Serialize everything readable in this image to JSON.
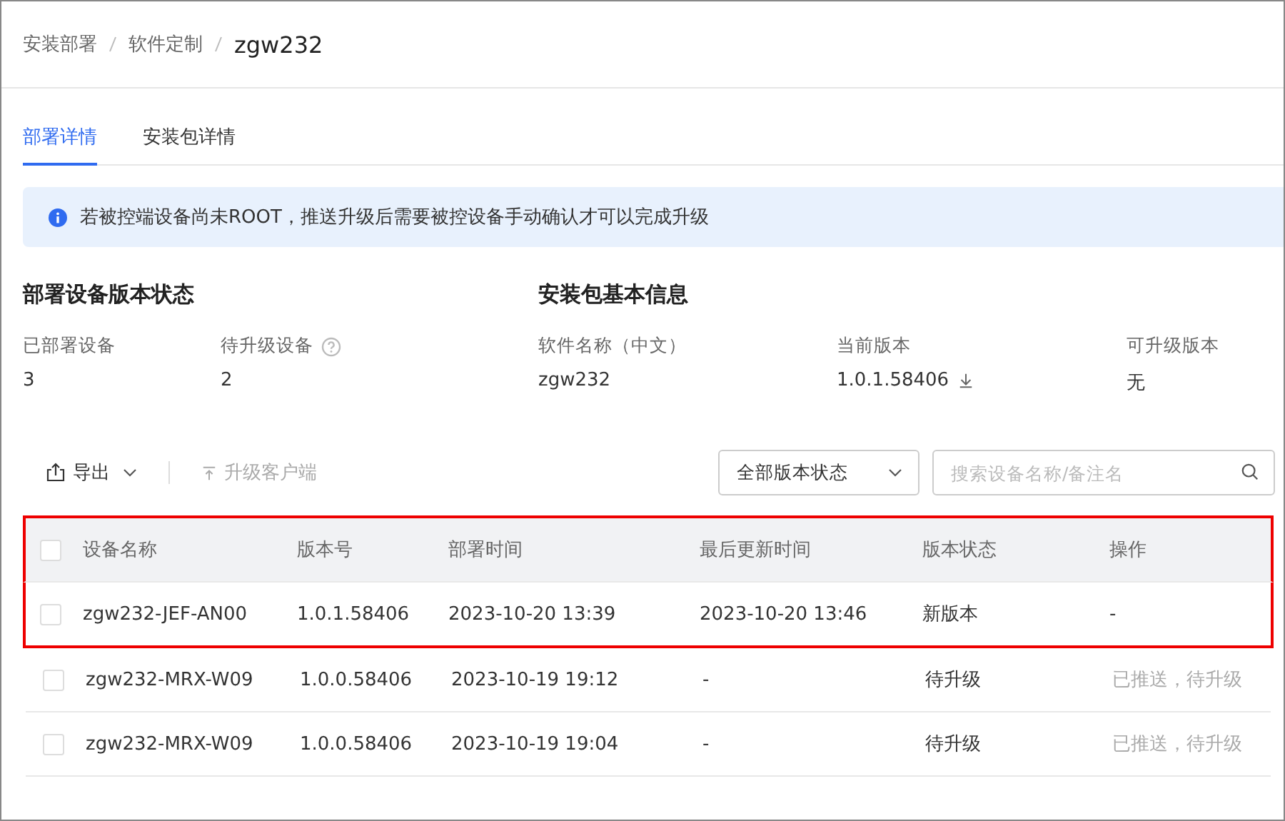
{
  "breadcrumb": [
    {
      "label": "安装部署",
      "current": false
    },
    {
      "label": "软件定制",
      "current": false
    },
    {
      "label": "zgw232",
      "current": true
    }
  ],
  "tabs": [
    {
      "label": "部署详情",
      "selected": true
    },
    {
      "label": "安装包详情",
      "selected": false
    }
  ],
  "alert": {
    "text": "若被控端设备尚未ROOT，推送升级后需要被控设备手动确认才可以完成升级"
  },
  "deploy_status": {
    "title": "部署设备版本状态",
    "stats": [
      {
        "label": "已部署设备",
        "value": "3",
        "help": false
      },
      {
        "label": "待升级设备",
        "value": "2",
        "help": true
      }
    ]
  },
  "package_info": {
    "title": "安装包基本信息",
    "fields": [
      {
        "label": "软件名称（中文）",
        "value": "zgw232",
        "download": false
      },
      {
        "label": "当前版本",
        "value": "1.0.1.58406",
        "download": true
      },
      {
        "label": "可升级版本",
        "value": "无",
        "download": false
      }
    ]
  },
  "toolbar": {
    "export": "导出",
    "upgrade": {
      "label": "升级客户端",
      "disabled": true
    },
    "filter": "全部版本状态",
    "search": {
      "placeholder": "搜索设备名称/备注名"
    }
  },
  "table": {
    "header_highlighted": true,
    "columns": [
      "设备名称",
      "版本号",
      "部署时间",
      "最后更新时间",
      "版本状态",
      "操作"
    ],
    "rows": [
      {
        "checked": false,
        "highlighted": true,
        "cells": [
          "zgw232-JEF-AN00",
          "1.0.1.58406",
          "2023-10-20 13:39",
          "2023-10-20 13:46",
          "新版本"
        ],
        "operation": {
          "text": "-",
          "disabled": false
        }
      },
      {
        "checked": false,
        "highlighted": false,
        "cells": [
          "zgw232-MRX-W09",
          "1.0.0.58406",
          "2023-10-19 19:12",
          "-",
          "待升级"
        ],
        "operation": {
          "text": "已推送，待升级",
          "disabled": true
        }
      },
      {
        "checked": false,
        "highlighted": false,
        "cells": [
          "zgw232-MRX-W09",
          "1.0.0.58406",
          "2023-10-19 19:04",
          "-",
          "待升级"
        ],
        "operation": {
          "text": "已推送，待升级",
          "disabled": true
        }
      }
    ]
  }
}
